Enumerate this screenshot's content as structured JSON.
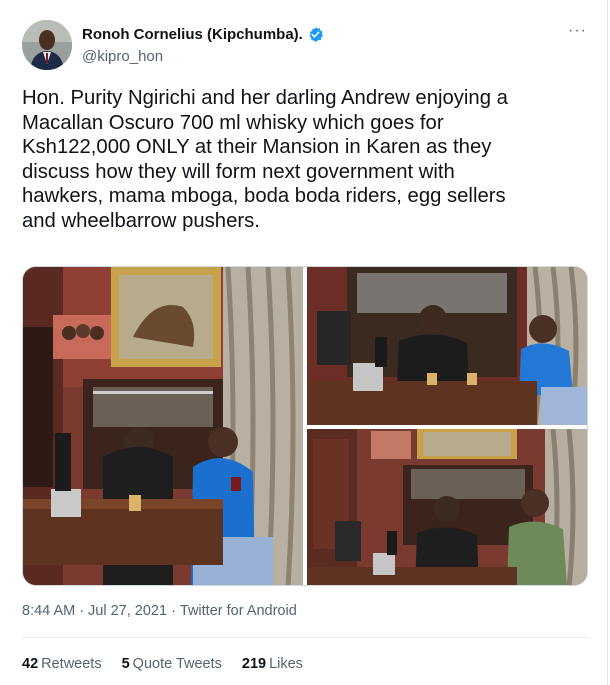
{
  "tweet": {
    "author_name": "Ronoh Cornelius (Kipchumba).",
    "handle": "@kipro_hon",
    "more_icon": "more-horizontal-icon",
    "verified_color": "#1d9bf0",
    "text": "Hon. Purity Ngirichi and her darling Andrew enjoying a\nMacallan Oscuro 700 ml whisky which goes for\nKsh122,000 ONLY at their Mansion in Karen as they\ndiscuss how they will form next government with\nhawkers, mama mboga, boda boda riders, egg sellers\nand wheelbarrow pushers.",
    "time": "8:44 AM",
    "date": "Jul 27, 2021",
    "separator": "·",
    "source": "Twitter for Android",
    "stats": [
      {
        "count": "42",
        "label": "Retweets"
      },
      {
        "count": "5",
        "label": "Quote Tweets"
      },
      {
        "count": "219",
        "label": "Likes"
      }
    ]
  }
}
